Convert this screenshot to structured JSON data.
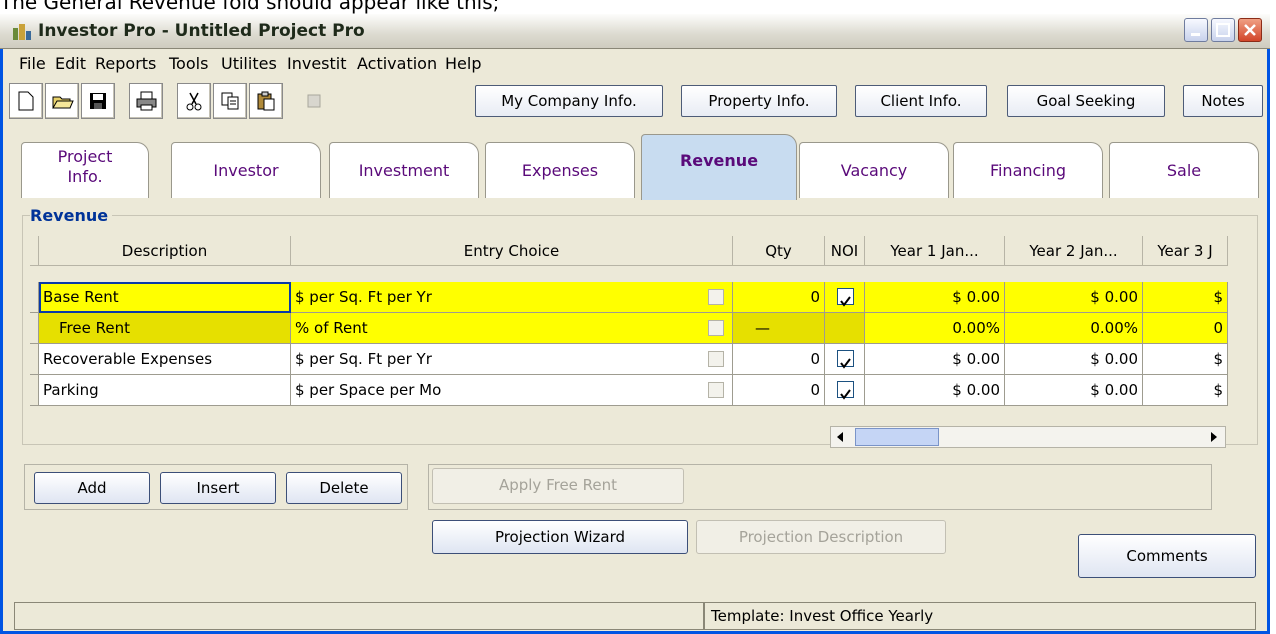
{
  "caption": "The General Revenue fold should appear like this;",
  "window": {
    "title": "Investor Pro  - Untitled Project Pro"
  },
  "menu": [
    "File",
    "Edit",
    "Reports",
    "Tools",
    "Utilites",
    "Investit",
    "Activation",
    "Help"
  ],
  "toolbar_buttons": {
    "my_company": "My Company Info.",
    "property": "Property Info.",
    "client": "Client Info.",
    "goal": "Goal Seeking",
    "notes": "Notes"
  },
  "tabs": [
    {
      "line1": "Project",
      "line2": "Info."
    },
    {
      "line1": "Investor",
      "line2": ""
    },
    {
      "line1": "Investment",
      "line2": ""
    },
    {
      "line1": "Expenses",
      "line2": ""
    },
    {
      "line1": "Revenue",
      "line2": ""
    },
    {
      "line1": "Vacancy",
      "line2": ""
    },
    {
      "line1": "Financing",
      "line2": ""
    },
    {
      "line1": "Sale",
      "line2": ""
    }
  ],
  "group_label": "Revenue",
  "table": {
    "headers": [
      "Description",
      "Entry Choice",
      "Qty",
      "NOI",
      "Year 1 Jan...",
      "Year 2 Jan...",
      "Year 3 J"
    ],
    "rows": [
      {
        "desc": "Base Rent",
        "entry": "$ per Sq. Ft per Yr",
        "qty": "0",
        "noi": true,
        "y1": "$ 0.00",
        "y2": "$ 0.00",
        "y3": "$"
      },
      {
        "desc": "Free Rent",
        "entry": "% of Rent",
        "qty": "—",
        "noi": false,
        "y1": "0.00%",
        "y2": "0.00%",
        "y3": "0"
      },
      {
        "desc": "Recoverable Expenses",
        "entry": "$ per Sq. Ft per Yr",
        "qty": "0",
        "noi": true,
        "y1": "$ 0.00",
        "y2": "$ 0.00",
        "y3": "$"
      },
      {
        "desc": "Parking",
        "entry": "$ per Space per Mo",
        "qty": "0",
        "noi": true,
        "y1": "$ 0.00",
        "y2": "$ 0.00",
        "y3": "$"
      }
    ]
  },
  "buttons": {
    "add": "Add",
    "insert": "Insert",
    "delete": "Delete",
    "apply_free_rent": "Apply Free Rent",
    "projection_wizard": "Projection Wizard",
    "projection_description": "Projection Description",
    "comments": "Comments"
  },
  "status": {
    "left": "",
    "template": "Template: Invest Office Yearly"
  }
}
